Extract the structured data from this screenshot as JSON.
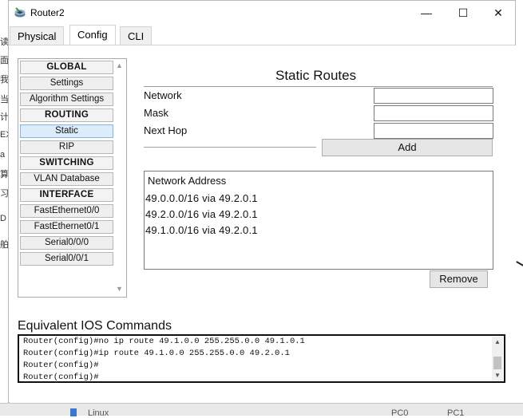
{
  "window": {
    "title": "Router2",
    "controls": {
      "minimize": "—",
      "maximize": "☐",
      "close": "✕"
    }
  },
  "tabs": [
    {
      "label": "Physical",
      "active": false
    },
    {
      "label": "Config",
      "active": true
    },
    {
      "label": "CLI",
      "active": false
    }
  ],
  "nav": {
    "items": [
      {
        "label": "GLOBAL",
        "type": "header"
      },
      {
        "label": "Settings",
        "type": "item"
      },
      {
        "label": "Algorithm Settings",
        "type": "item"
      },
      {
        "label": "ROUTING",
        "type": "header"
      },
      {
        "label": "Static",
        "type": "item",
        "selected": true
      },
      {
        "label": "RIP",
        "type": "item"
      },
      {
        "label": "SWITCHING",
        "type": "header"
      },
      {
        "label": "VLAN Database",
        "type": "item"
      },
      {
        "label": "INTERFACE",
        "type": "header"
      },
      {
        "label": "FastEthernet0/0",
        "type": "item"
      },
      {
        "label": "FastEthernet0/1",
        "type": "item"
      },
      {
        "label": "Serial0/0/0",
        "type": "item"
      },
      {
        "label": "Serial0/0/1",
        "type": "item"
      }
    ]
  },
  "static_routes": {
    "title": "Static Routes",
    "network_label": "Network",
    "mask_label": "Mask",
    "next_hop_label": "Next Hop",
    "network_value": "",
    "mask_value": "",
    "next_hop_value": "",
    "add_label": "Add",
    "list_header": "Network Address",
    "routes": [
      "49.0.0.0/16 via 49.2.0.1",
      "49.2.0.0/16 via 49.2.0.1",
      "49.1.0.0/16 via 49.2.0.1"
    ],
    "remove_label": "Remove"
  },
  "ios": {
    "title": "Equivalent IOS Commands",
    "lines": [
      "Router(config)#no ip route 49.1.0.0 255.255.0.0 49.1.0.1",
      "Router(config)#ip route 49.1.0.0 255.255.0.0 49.2.0.1",
      "Router(config)#",
      "Router(config)#"
    ]
  },
  "background": {
    "bottom_labels": [
      "Linux",
      "PC0",
      "PC1"
    ],
    "left_glyphs": [
      "读",
      "面",
      "我",
      "当",
      "计",
      "EX",
      "a",
      "算",
      "习",
      "D",
      "舶"
    ]
  },
  "icons": {
    "app": "router-app-icon",
    "scroll_up": "▲",
    "scroll_down": "▼",
    "nav_up": "▲",
    "nav_down": "▼"
  }
}
